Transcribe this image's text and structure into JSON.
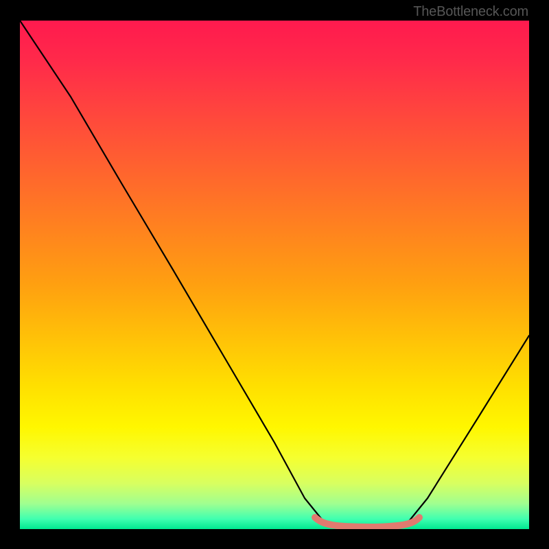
{
  "attribution": "TheBottleneck.com",
  "chart_data": {
    "type": "line",
    "title": "",
    "xlabel": "",
    "ylabel": "",
    "xlim": [
      0,
      100
    ],
    "ylim": [
      0,
      100
    ],
    "series": [
      {
        "name": "bottleneck-curve",
        "x": [
          0,
          10,
          20,
          30,
          40,
          50,
          56,
          60,
          64,
          68,
          72,
          76,
          80,
          90,
          100
        ],
        "y": [
          100,
          85,
          68,
          51,
          34,
          17,
          6,
          1,
          0,
          0,
          0,
          1,
          6,
          22,
          38
        ]
      },
      {
        "name": "sweet-spot-marker",
        "x": [
          58,
          60,
          64,
          68,
          72,
          76,
          78
        ],
        "y": [
          2.2,
          1,
          0.3,
          0.3,
          0.3,
          1,
          2.2
        ]
      }
    ],
    "colors": {
      "curve": "#000000",
      "marker": "#e17a6f",
      "gradient_top": "#ff1a4e",
      "gradient_bottom": "#00e890"
    }
  }
}
